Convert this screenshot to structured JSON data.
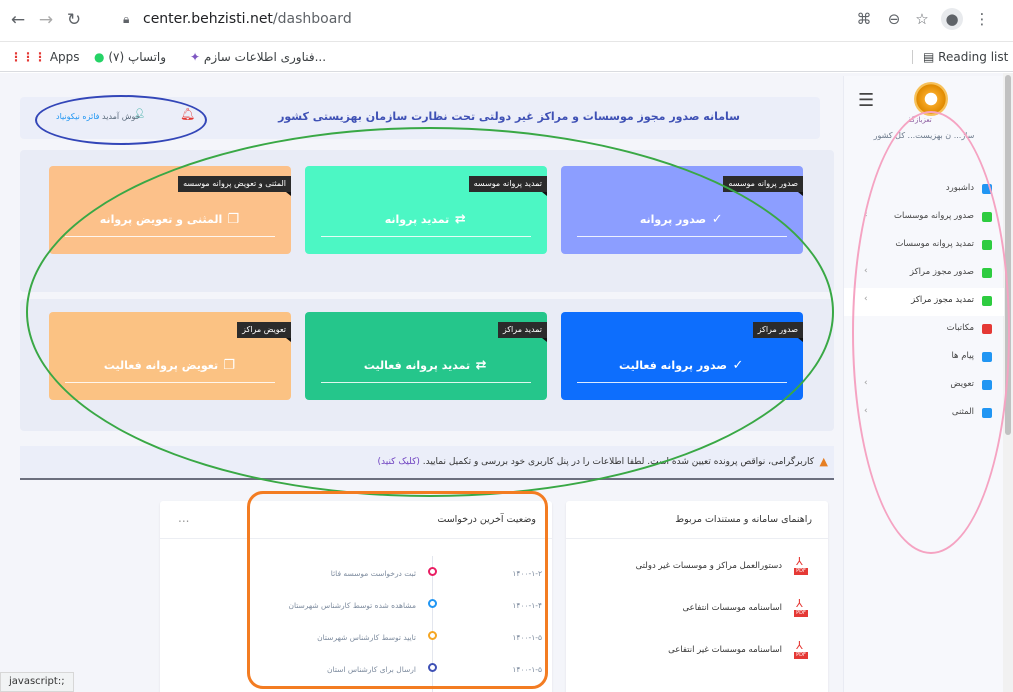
{
  "browser": {
    "url_host": "center.behzisti.net",
    "url_path": "/dashboard",
    "bookmarks": {
      "apps": "Apps",
      "whatsapp": "(۷) واتساپ",
      "it_org": "فناوری اطلاعات سازم...",
      "reading_list": "Reading list"
    },
    "status_text": "javascript:;"
  },
  "sidebar": {
    "logo_text": "تعز‌بازگذ",
    "org_name": "ساز... ن بهزیست... کل کشور",
    "items": [
      {
        "label": "داشبورد",
        "color": "#2196f3",
        "active": false,
        "has_chevron": false
      },
      {
        "label": "صدور پروانه موسسات",
        "color": "#2ecc40",
        "active": false,
        "has_chevron": true
      },
      {
        "label": "تمدید پروانه موسسات",
        "color": "#2ecc40",
        "active": false,
        "has_chevron": false
      },
      {
        "label": "صدور مجوز مراکز",
        "color": "#2ecc40",
        "active": false,
        "has_chevron": true
      },
      {
        "label": "تمدید مجوز مراکز",
        "color": "#2ecc40",
        "active": true,
        "has_chevron": true
      },
      {
        "label": "مکاتبات",
        "color": "#e53935",
        "active": false,
        "has_chevron": false
      },
      {
        "label": "پیام ها",
        "color": "#2196f3",
        "active": false,
        "has_chevron": false
      },
      {
        "label": "تعویض",
        "color": "#2196f3",
        "active": false,
        "has_chevron": true
      },
      {
        "label": "المثنی",
        "color": "#2196f3",
        "active": false,
        "has_chevron": true
      }
    ]
  },
  "header": {
    "title": "سامانه صدور مجوز موسسات و مراکز غیر دولتی تحت نظارت سازمان بهزیستی کشور",
    "welcome": "خوش آمدید",
    "user_name": "فائزه نیکونیاد"
  },
  "cards_row1": [
    {
      "tag": "صدور پروانه موسسه",
      "label": "صدور پروانه",
      "icon": "check-circle-icon",
      "color": "#8c9eff"
    },
    {
      "tag": "تمدید پروانه موسسه",
      "label": "تمدید پروانه",
      "icon": "renew-icon",
      "color": "#4cf7c4"
    },
    {
      "tag": "المثنی و تعویض پروانه موسسه",
      "label": "المثنی و تعویض پروانه",
      "icon": "copy-icon",
      "color": "#fcc18a"
    }
  ],
  "cards_row2": [
    {
      "tag": "صدور مراکز",
      "label": "صدور پروانه فعالیت",
      "icon": "check-circle-icon",
      "color": "#0d6efd"
    },
    {
      "tag": "تمدید مراکز",
      "label": "تمدید پروانه فعالیت",
      "icon": "renew-icon",
      "color": "#25c68b"
    },
    {
      "tag": "تعویض مراکز",
      "label": "تعویض پروانه فعالیت",
      "icon": "copy-icon",
      "color": "#fbc283"
    }
  ],
  "alert": {
    "text": "کاربرگرامی، نواقص پرونده تعیین شده است. لطفا اطلاعات را در پنل کاربری خود بررسی و تکمیل نمایید.",
    "link": "(کلیک کنید)"
  },
  "docs_panel": {
    "title": "راهنمای سامانه و مستندات مربوط",
    "items": [
      "دستورالعمل مراکز و موسسات غیر دولتی",
      "اساسنامه موسسات انتفاعی",
      "اساسنامه موسسات غیر انتفاعی"
    ]
  },
  "status_panel": {
    "title": "وضعیت آخرین درخواست",
    "menu": "...",
    "events": [
      {
        "text": "ثبت درخواست موسسه فائا",
        "date": "۱۴۰۰-۱-۲",
        "color": "#e91e63"
      },
      {
        "text": "مشاهده شده توسط کارشناس شهرستان",
        "date": "۱۴۰۰-۱-۴",
        "color": "#2196f3"
      },
      {
        "text": "تایید توسط کارشناس شهرستان",
        "date": "۱۴۰۰-۱-۵",
        "color": "#f5a623"
      },
      {
        "text": "ارسال برای کارشناس استان",
        "date": "۱۴۰۰-۱-۵",
        "color": "#3f51b5"
      }
    ]
  }
}
